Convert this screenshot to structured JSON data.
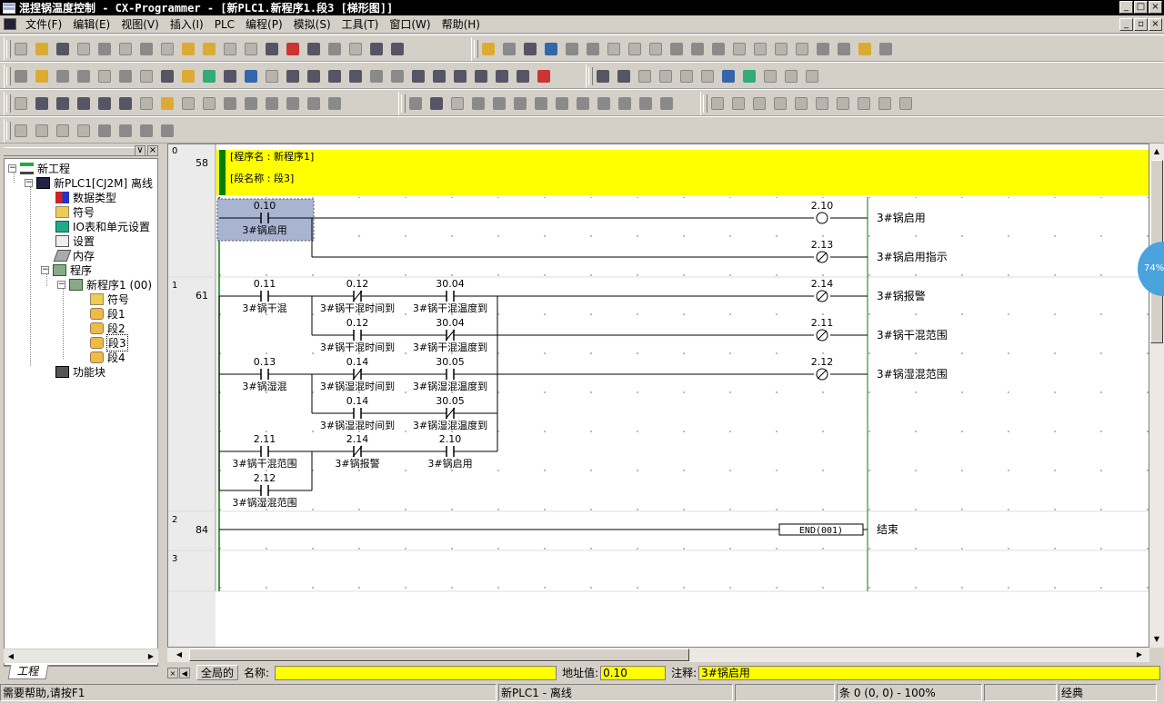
{
  "window": {
    "title": "混捏锅温度控制 - CX-Programmer - [新PLC1.新程序1.段3 [梯形图]]",
    "min_label": "_",
    "max_label": "□",
    "close_label": "×",
    "mdi_min_label": "_",
    "mdi_restore_label": "▫",
    "mdi_close_label": "×"
  },
  "menu": [
    "文件(F)",
    "编辑(E)",
    "视图(V)",
    "插入(I)",
    "PLC",
    "编程(P)",
    "模拟(S)",
    "工具(T)",
    "窗口(W)",
    "帮助(H)"
  ],
  "tree": {
    "panel_close": "×",
    "panel_pin": "∨",
    "nodes": [
      {
        "label": "新工程",
        "icon": "network-icon",
        "expander": "−"
      },
      {
        "label": "新PLC1[CJ2M] 离线",
        "icon": "plc-icon",
        "expander": "−"
      },
      {
        "label": "数据类型",
        "icon": "datatype-icon"
      },
      {
        "label": "符号",
        "icon": "symbols-icon"
      },
      {
        "label": "IO表和单元设置",
        "icon": "io-table-icon"
      },
      {
        "label": "设置",
        "icon": "settings-icon"
      },
      {
        "label": "内存",
        "icon": "memory-icon"
      },
      {
        "label": "程序",
        "icon": "programs-icon",
        "expander": "−"
      },
      {
        "label": "新程序1 (00)",
        "icon": "program-icon",
        "expander": "−"
      },
      {
        "label": "符号",
        "icon": "symbols-icon"
      },
      {
        "label": "段1",
        "icon": "section-icon"
      },
      {
        "label": "段2",
        "icon": "section-icon"
      },
      {
        "label": "段3",
        "icon": "section-icon",
        "selected": true
      },
      {
        "label": "段4",
        "icon": "section-icon"
      },
      {
        "label": "功能块",
        "icon": "function-block-icon"
      }
    ],
    "tab_label": "工程"
  },
  "ladder": {
    "header_program": "[程序名 : 新程序1]",
    "header_section": "[段名称 : 段3]",
    "rung_numbers": [
      "0",
      "1",
      "2",
      "3"
    ],
    "step_numbers": [
      "58",
      "61",
      "84"
    ],
    "contacts": [
      {
        "addr": "0.10",
        "comment": "3#锅启用",
        "type": "no",
        "selected": true
      },
      {
        "addr": "0.11",
        "comment": "3#锅干混",
        "type": "no"
      },
      {
        "addr": "0.12",
        "comment": "3#锅干混时间到",
        "type": "nc"
      },
      {
        "addr": "30.04",
        "comment": "3#锅干混温度到",
        "type": "no"
      },
      {
        "addr": "0.12",
        "comment": "3#锅干混时间到",
        "type": "no"
      },
      {
        "addr": "30.04",
        "comment": "3#锅干混温度到",
        "type": "nc"
      },
      {
        "addr": "0.13",
        "comment": "3#锅湿混",
        "type": "no"
      },
      {
        "addr": "0.14",
        "comment": "3#锅湿混时间到",
        "type": "nc"
      },
      {
        "addr": "30.05",
        "comment": "3#锅湿混温度到",
        "type": "no"
      },
      {
        "addr": "0.14",
        "comment": "3#锅湿混时间到",
        "type": "no"
      },
      {
        "addr": "30.05",
        "comment": "3#锅湿混温度到",
        "type": "nc"
      },
      {
        "addr": "2.11",
        "comment": "3#锅干混范围",
        "type": "no"
      },
      {
        "addr": "2.14",
        "comment": "3#锅报警",
        "type": "nc"
      },
      {
        "addr": "2.10",
        "comment": "3#锅启用",
        "type": "no"
      },
      {
        "addr": "2.12",
        "comment": "3#锅湿混范围",
        "type": "no"
      }
    ],
    "coils": [
      {
        "addr": "2.10",
        "comment": "3#锅启用",
        "type": "normal"
      },
      {
        "addr": "2.13",
        "comment": "3#锅启用指示",
        "type": "negated"
      },
      {
        "addr": "2.14",
        "comment": "3#锅报警",
        "type": "negated"
      },
      {
        "addr": "2.11",
        "comment": "3#锅干混范围",
        "type": "negated"
      },
      {
        "addr": "2.12",
        "comment": "3#锅湿混范围",
        "type": "negated"
      }
    ],
    "end_instruction": "END(001)",
    "end_comment": "结束"
  },
  "zoom_badge": "74%",
  "scroll_arrows": {
    "up": "▲",
    "down": "▼",
    "left": "◀",
    "right": "▶"
  },
  "infobar": {
    "nav_prev": "◀",
    "nav_close": "×",
    "scope": "全局的",
    "name_label": "名称:",
    "name_value": "",
    "address_label": "地址值:",
    "address_value": "0.10",
    "comment_label": "注释:",
    "comment_value": "3#锅启用"
  },
  "status": {
    "help": "需要帮助,请按F1",
    "plc": "新PLC1 - 离线",
    "position": "条 0 (0, 0) - 100%",
    "mode": "经典"
  },
  "colors": {
    "header_bg": "#ffff00",
    "header_bar": "#008000",
    "selection": "#a8b4d0",
    "rail": "#008000"
  }
}
